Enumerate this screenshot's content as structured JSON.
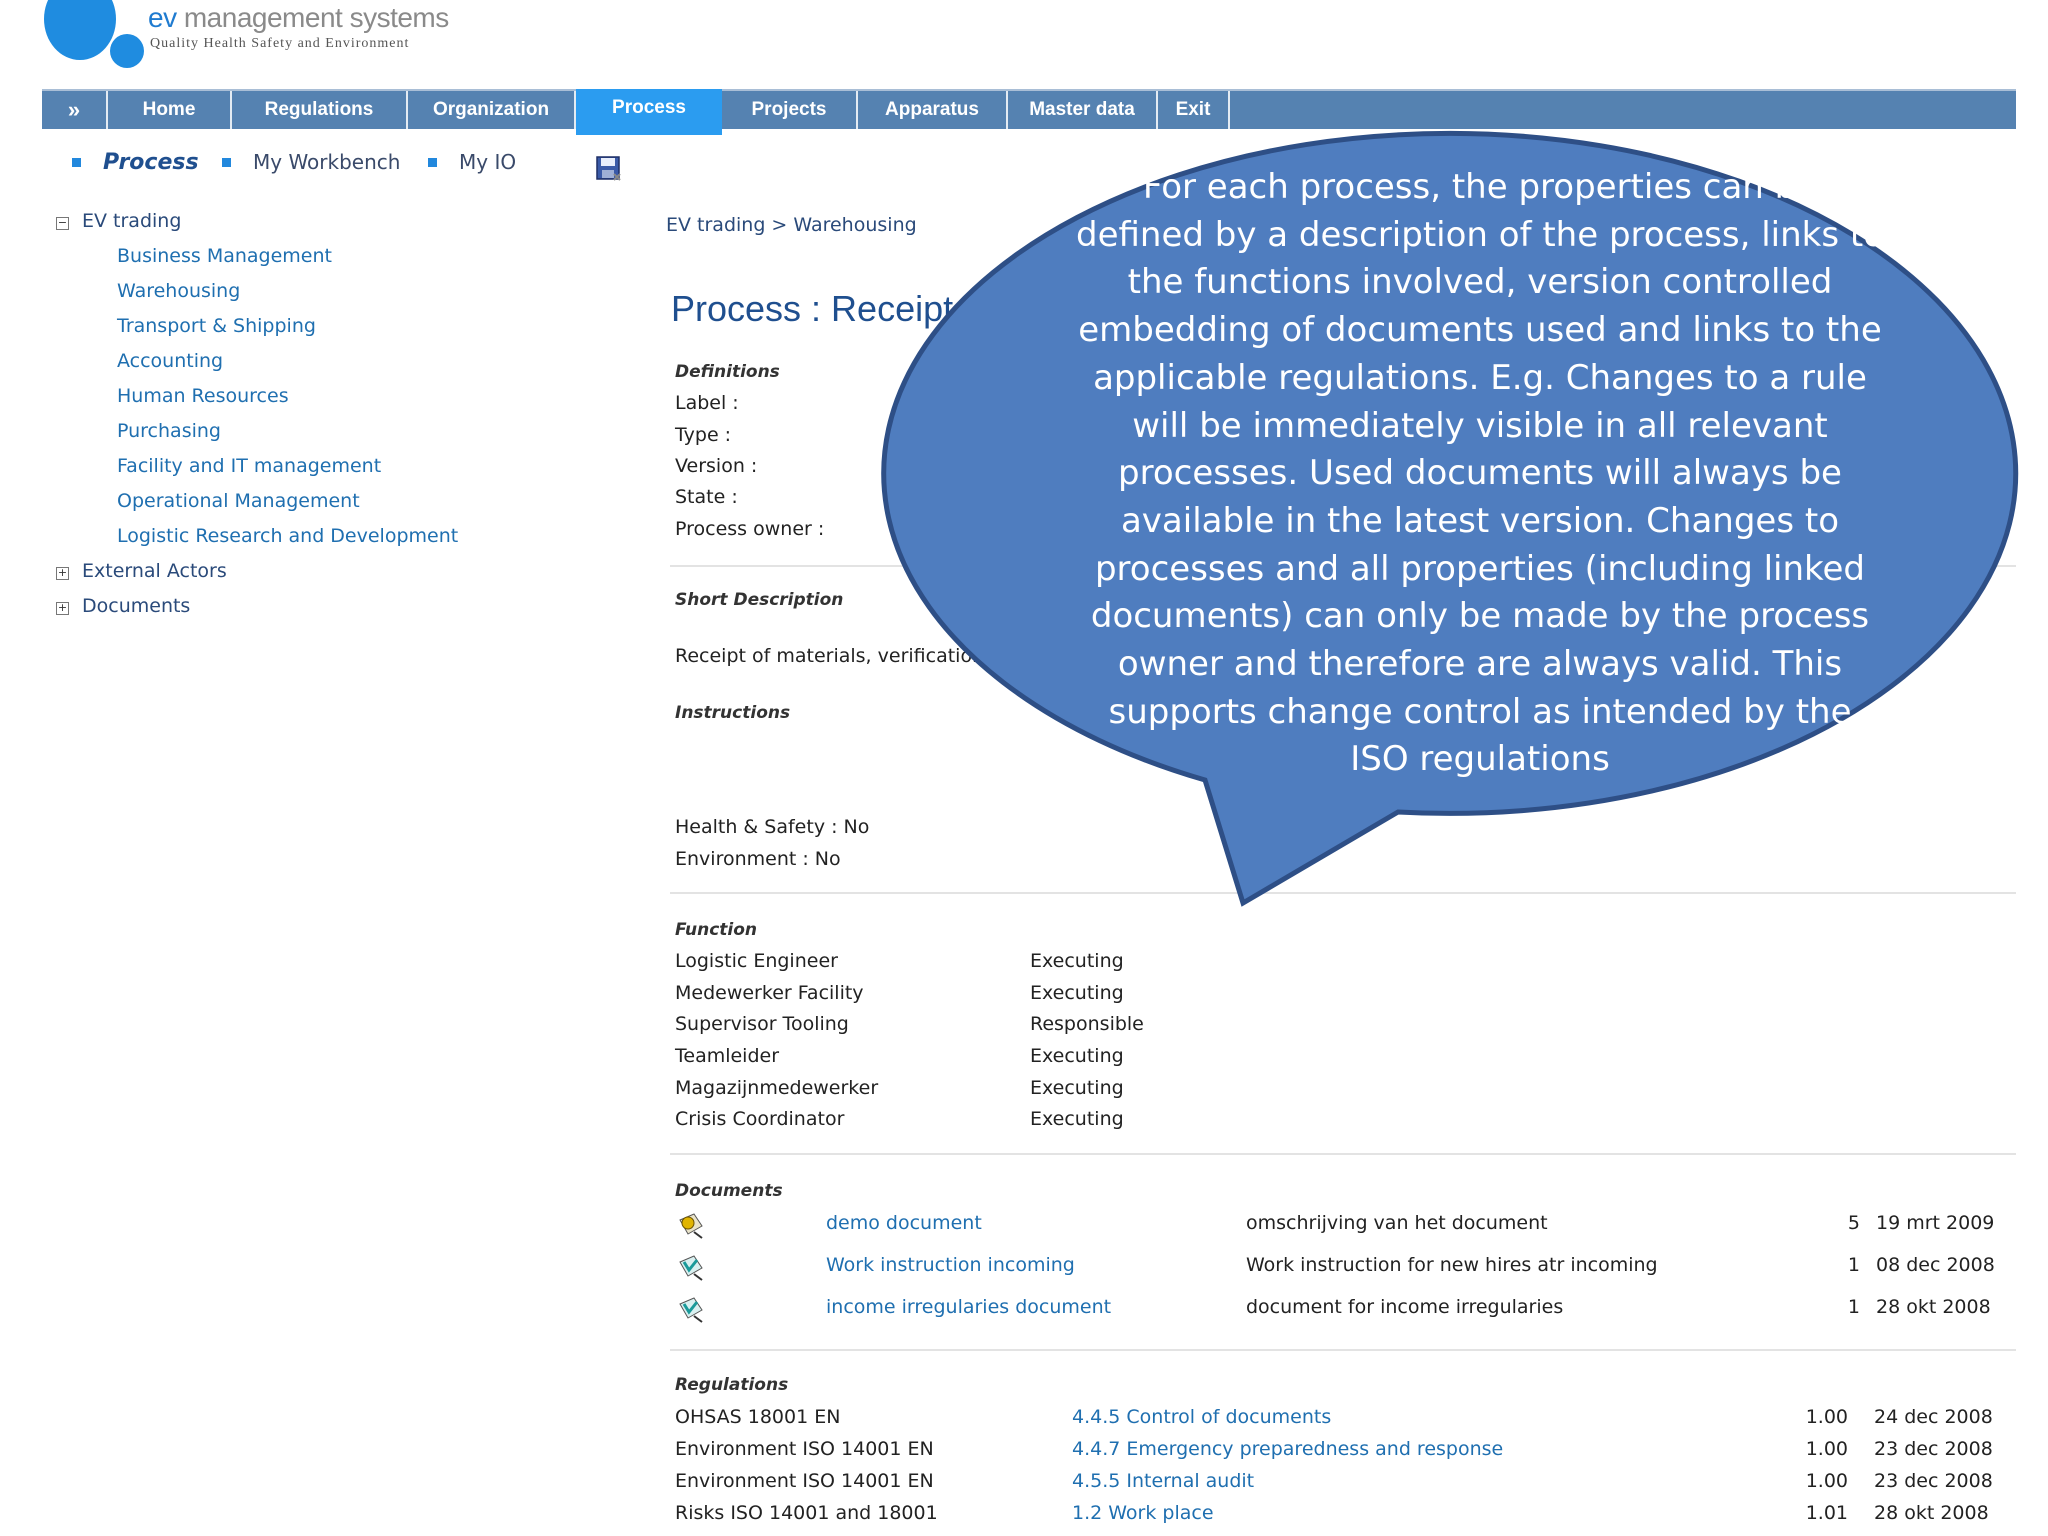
{
  "logo": {
    "brand_prefix": "ev",
    "brand_suffix": " management systems",
    "tagline": "Quality Health Safety and Environment"
  },
  "nav": {
    "expand_glyph": "»",
    "items": [
      "Home",
      "Regulations",
      "Organization",
      "Process",
      "Projects",
      "Apparatus",
      "Master data",
      "Exit"
    ],
    "active": "Process"
  },
  "subnav": {
    "process": "Process",
    "workbench": "My Workbench",
    "io": "My IO"
  },
  "tree": {
    "root": "EV trading",
    "children": [
      "Business Management",
      "Warehousing",
      "Transport & Shipping",
      "Accounting",
      "Human Resources",
      "Purchasing",
      "Facility and IT management",
      "Operational Management",
      "Logistic Research and Development"
    ],
    "others": [
      "External Actors",
      "Documents"
    ],
    "collapse_glyph": "−",
    "expand_glyph": "+"
  },
  "breadcrumb": "EV trading > Warehousing",
  "title": "Process : Receipt",
  "definitions": {
    "heading": "Definitions",
    "label": "Label :",
    "type": "Type :",
    "version": "Version :",
    "state": "State :",
    "owner": "Process owner :"
  },
  "short_description": {
    "heading": "Short Description",
    "text": "Receipt of materials, verification"
  },
  "instructions": {
    "heading": "Instructions"
  },
  "flags": {
    "health_safety": "Health & Safety : No",
    "environment": "Environment : No"
  },
  "function": {
    "heading": "Function",
    "rows": [
      {
        "name": "Logistic Engineer",
        "role": "Executing"
      },
      {
        "name": "Medewerker Facility",
        "role": "Executing"
      },
      {
        "name": "Supervisor Tooling",
        "role": "Responsible"
      },
      {
        "name": "Teamleider",
        "role": "Executing"
      },
      {
        "name": "Magazijnmedewerker",
        "role": "Executing"
      },
      {
        "name": "Crisis Coordinator",
        "role": "Executing"
      }
    ]
  },
  "documents": {
    "heading": "Documents",
    "rows": [
      {
        "name": "demo document",
        "desc": "omschrijving van het document",
        "version": "5",
        "date": "19 mrt 2009"
      },
      {
        "name": "Work instruction incoming",
        "desc": "Work instruction for new hires atr incoming",
        "version": "1",
        "date": "08 dec 2008"
      },
      {
        "name": "income irregularies document",
        "desc": "document for income irregularies",
        "version": "1",
        "date": "28 okt 2008"
      }
    ]
  },
  "regulations": {
    "heading": "Regulations",
    "rows": [
      {
        "standard": "OHSAS 18001 EN",
        "clause": "4.4.5 Control of documents",
        "version": "1.00",
        "date": "24 dec 2008"
      },
      {
        "standard": "Environment ISO 14001 EN",
        "clause": "4.4.7 Emergency preparedness and response",
        "version": "1.00",
        "date": "23 dec 2008"
      },
      {
        "standard": "Environment ISO 14001 EN",
        "clause": "4.5.5 Internal audit",
        "version": "1.00",
        "date": "23 dec 2008"
      },
      {
        "standard": "Risks ISO 14001 and 18001",
        "clause": "1.2 Work place",
        "version": "1.01",
        "date": "28 okt 2008"
      }
    ]
  },
  "callout": {
    "text": "For each process, the properties can be defined by a description of the process, links to the functions involved, version controlled embedding of documents used and links to the applicable regulations. E.g. Changes to a rule will be immediately visible in all relevant processes. Used documents will always be available in the latest version. Changes to processes and all properties (including linked documents) can only be made by the process owner and therefore are always valid. This supports change control as intended by the ISO regulations",
    "fill": "#4f7dbf",
    "stroke": "#2e4f86"
  }
}
